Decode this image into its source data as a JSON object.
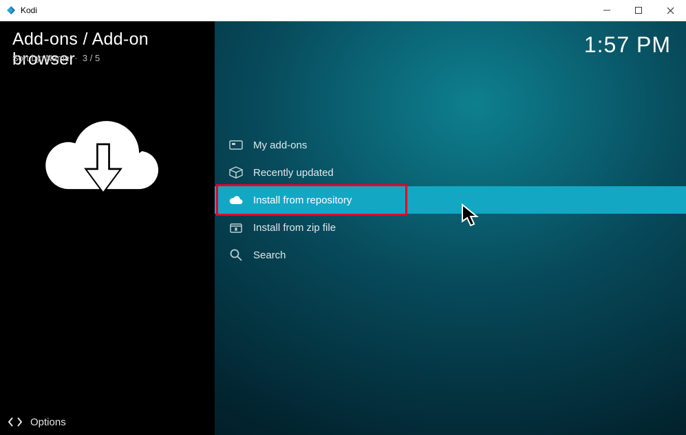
{
  "window": {
    "title": "Kodi"
  },
  "header": {
    "breadcrumb": "Add-ons / Add-on browser",
    "sort_label": "Sort by: Name",
    "position": "3 / 5",
    "clock": "1:57 PM"
  },
  "menu": {
    "items": [
      {
        "key": "my-add-ons",
        "label": "My add-ons",
        "icon": "addons"
      },
      {
        "key": "recently-updated",
        "label": "Recently updated",
        "icon": "box"
      },
      {
        "key": "install-from-repository",
        "label": "Install from repository",
        "icon": "cloud"
      },
      {
        "key": "install-from-zip-file",
        "label": "Install from zip file",
        "icon": "zip"
      },
      {
        "key": "search",
        "label": "Search",
        "icon": "search"
      }
    ],
    "selected_index": 2
  },
  "footer": {
    "options_label": "Options"
  }
}
